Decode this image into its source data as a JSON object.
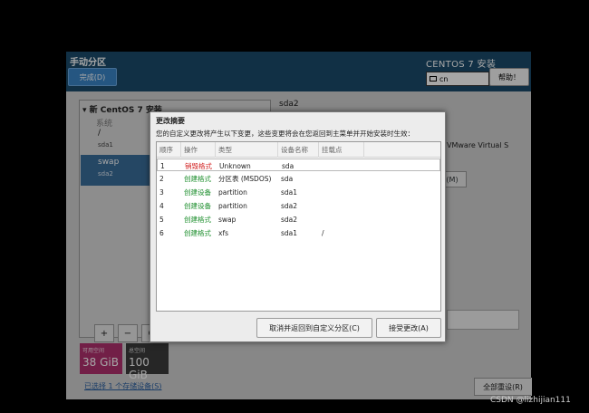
{
  "header": {
    "title": "手动分区",
    "done_label": "完成(D)",
    "installer_title": "CENTOS 7 安装",
    "keyboard_layout": "cn",
    "help_label": "帮助！"
  },
  "left_panel": {
    "tree_header": "新 CentOS 7 安装",
    "group_label": "系统",
    "items": [
      {
        "mount": "/",
        "device": "sda1"
      },
      {
        "mount": "swap",
        "device": "sda2"
      }
    ],
    "controls": {
      "add": "+",
      "remove": "−",
      "refresh": "C"
    }
  },
  "right_panel": {
    "title": "sda2",
    "device_text": "VMware Virtual S",
    "modify_label": "(M)",
    "colon": ":"
  },
  "space": {
    "available_label": "可用空间",
    "available_value": "38 GiB",
    "total_label": "总空间",
    "total_value": "100 GiB"
  },
  "storage_link": "已选择 1 个存储设备(S)",
  "reset_label": "全部重设(R)",
  "dialog": {
    "title": "更改摘要",
    "description": "您的自定义更改将产生以下变更，这些变更将会在您返回到主菜单并开始安装时生效：",
    "columns": [
      "顺序",
      "操作",
      "类型",
      "设备名称",
      "挂载点"
    ],
    "rows": [
      {
        "order": "1",
        "action": "销毁格式",
        "action_color": "red",
        "type": "Unknown",
        "device": "sda",
        "mount": ""
      },
      {
        "order": "2",
        "action": "创建格式",
        "action_color": "green",
        "type": "分区表 (MSDOS)",
        "device": "sda",
        "mount": ""
      },
      {
        "order": "3",
        "action": "创建设备",
        "action_color": "green",
        "type": "partition",
        "device": "sda1",
        "mount": ""
      },
      {
        "order": "4",
        "action": "创建设备",
        "action_color": "green",
        "type": "partition",
        "device": "sda2",
        "mount": ""
      },
      {
        "order": "5",
        "action": "创建格式",
        "action_color": "green",
        "type": "swap",
        "device": "sda2",
        "mount": ""
      },
      {
        "order": "6",
        "action": "创建格式",
        "action_color": "green",
        "type": "xfs",
        "device": "sda1",
        "mount": "/"
      }
    ],
    "cancel_label": "取消并返回到自定义分区(C)",
    "accept_label": "接受更改(A)"
  },
  "watermark": "CSDN @lizhijian111",
  "colors": {
    "header_bg": "#1b4b6b",
    "done_button": "#3a85c6",
    "destroy": "#d21f1f",
    "create": "#1e8f2e",
    "available_space": "#b0306e",
    "total_space": "#3b3b3b"
  }
}
